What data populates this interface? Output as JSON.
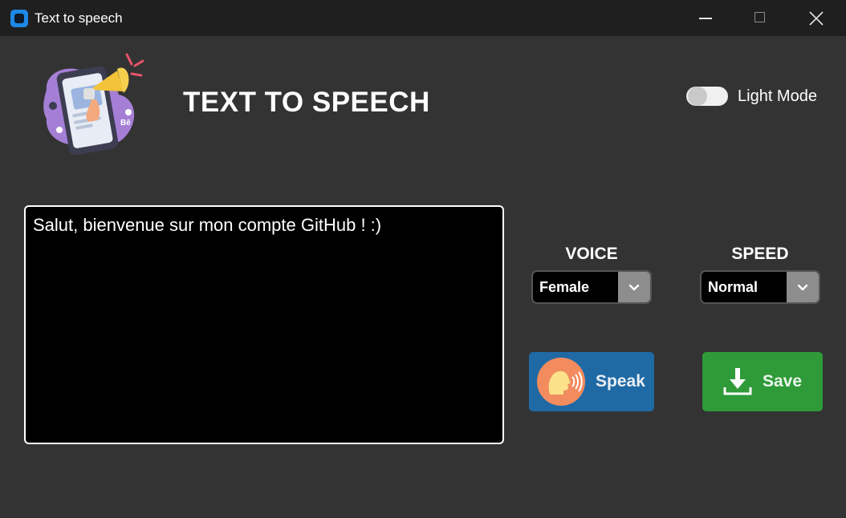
{
  "window": {
    "title": "Text to speech",
    "app_icon": "app-window-icon",
    "controls": [
      "minimize-icon",
      "maximize-icon",
      "close-icon"
    ]
  },
  "header": {
    "logo": "megaphone-phone-illustration",
    "title": "TEXT TO SPEECH",
    "theme_toggle_label": "Light Mode",
    "theme_toggle_on": false
  },
  "editor": {
    "text": "Salut, bienvenue sur mon compte GitHub ! :)"
  },
  "voice": {
    "label": "VOICE",
    "selected": "Female"
  },
  "speed": {
    "label": "SPEED",
    "selected": "Normal"
  },
  "actions": {
    "speak_label": "Speak",
    "speak_icon": "speaking-head-icon",
    "save_label": "Save",
    "save_icon": "download-icon"
  },
  "colors": {
    "background": "#333333",
    "titlebar": "#1f1f1f",
    "speak_button": "#1f6aa5",
    "save_button": "#2e9a38",
    "textbox": "#000000"
  }
}
